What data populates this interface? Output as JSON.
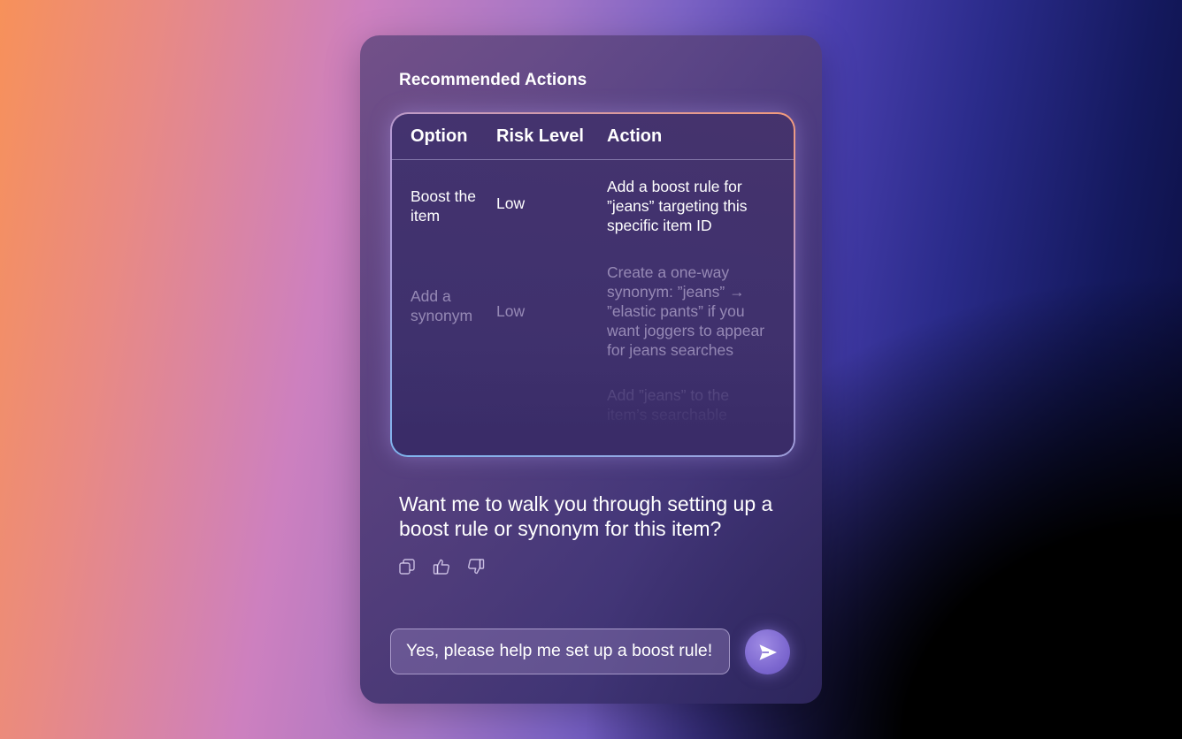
{
  "card": {
    "title": "Recommended Actions"
  },
  "table": {
    "headers": [
      "Option",
      "Risk Level",
      "Action"
    ],
    "rows": [
      {
        "option": [
          "Boost the",
          "item"
        ],
        "risk": "Low",
        "action": [
          "Add a boost rule for",
          "”jeans” targeting this",
          "specific item ID"
        ]
      },
      {
        "option": [
          "Add a",
          "synonym"
        ],
        "risk": "Low",
        "action": [
          "Create a one-way",
          "synonym: ”jeans” →",
          "”elastic pants” if you",
          "want joggers to appear",
          "for jeans searches"
        ]
      },
      {
        "option": [],
        "risk": "",
        "action": [
          "Add ”jeans” to the",
          "item’s searchable"
        ]
      }
    ]
  },
  "message": {
    "text": "Want me to walk you through setting up a boost rule or synonym for this item?",
    "actions": [
      "copy-icon",
      "thumbs-up-icon",
      "thumbs-down-icon"
    ]
  },
  "composer": {
    "value": "Yes, please help me set up a boost rule!",
    "send_icon": "send-icon"
  },
  "colors": {
    "accent": "#7d68d0",
    "text": "#ffffff"
  }
}
